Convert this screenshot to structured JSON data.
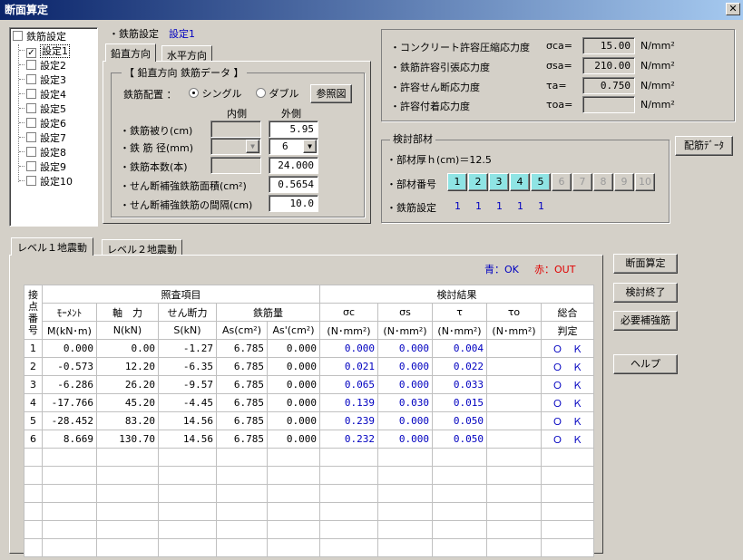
{
  "window": {
    "title": "断面算定",
    "close": "✕"
  },
  "tree": {
    "root": "鉄筋設定",
    "items": [
      "設定1",
      "設定2",
      "設定3",
      "設定4",
      "設定5",
      "設定6",
      "設定7",
      "設定8",
      "設定9",
      "設定10"
    ],
    "checked_index": 0
  },
  "settings": {
    "label": "・鉄筋設定",
    "current": "設定1"
  },
  "tabs_dir": [
    "鉛直方向",
    "水平方向"
  ],
  "rebar": {
    "group_title": "【 鉛直方向 鉄筋データ 】",
    "placement_label": "鉄筋配置 ：",
    "single": "シングル",
    "double": "ダブル",
    "ref_button": "参照図",
    "col_inner": "内側",
    "col_outer": "外側",
    "cover_label": "・鉄筋被り(cm)",
    "cover_value": "5.95",
    "dia_label": "・鉄 筋 径(mm)",
    "dia_value": "6",
    "count_label": "・鉄筋本数(本)",
    "count_value": "24.000",
    "shear_area_label": "・せん断補強鉄筋面積(cm²)",
    "shear_area_value": "0.5654",
    "shear_space_label": "・せん断補強鉄筋の間隔(cm)",
    "shear_space_value": "10.0"
  },
  "stress": {
    "rows": [
      {
        "label": "・コンクリート許容圧縮応力度",
        "sym": "σca=",
        "value": "15.00",
        "unit": "N/mm²"
      },
      {
        "label": "・鉄筋許容引張応力度",
        "sym": "σsa=",
        "value": "210.00",
        "unit": "N/mm²"
      },
      {
        "label": "・許容せん断応力度",
        "sym": "τa=",
        "value": "0.750",
        "unit": "N/mm²"
      },
      {
        "label": "・許容付着応力度",
        "sym": "τoa=",
        "value": "",
        "unit": "N/mm²"
      }
    ]
  },
  "member": {
    "group_title": "検討部材",
    "thickness": "・部材厚ｈ(cm)＝12.5",
    "num_label": "・部材番号",
    "numbers": [
      "1",
      "2",
      "3",
      "4",
      "5",
      "6",
      "7",
      "8",
      "9",
      "10"
    ],
    "active_count": 5,
    "setting_label": "・鉄筋設定",
    "settings": [
      "1",
      "1",
      "1",
      "1",
      "1"
    ],
    "rebar_data_button": "配筋ﾃﾞｰﾀ"
  },
  "level_tabs": [
    "レベル１地震動",
    "レベル２地震動"
  ],
  "legend": {
    "ok": "青：OK",
    "out": "赤：OUT"
  },
  "side_buttons": [
    "断面算定",
    "検討終了",
    "必要補強筋",
    "ヘルプ"
  ],
  "table": {
    "h_node": "接点番号",
    "h_check": "照査項目",
    "h_result": "検討結果",
    "h_moment": "ﾓｰﾒﾝﾄ",
    "h_axial": "軸　力",
    "h_shear": "せん断力",
    "h_rebar": "鉄筋量",
    "h_sc": "σc",
    "h_ss": "σs",
    "h_t": "τ",
    "h_to": "τo",
    "h_total": "総合",
    "u_moment": "M(kN･m)",
    "u_axial": "N(kN)",
    "u_shear": "S(kN)",
    "u_as": "As(cm²)",
    "u_as2": "As'(cm²)",
    "u_sc": "(N･mm²)",
    "u_ss": "(N･mm²)",
    "u_t": "(N･mm²)",
    "u_to": "(N･mm²)",
    "u_total": "判定",
    "rows": [
      {
        "n": "1",
        "m": "0.000",
        "ax": "0.00",
        "s": "-1.27",
        "as": "6.785",
        "as2": "0.000",
        "sc": "0.000",
        "ss": "0.000",
        "t": "0.004",
        "to": "",
        "j": "Ｏ　Ｋ"
      },
      {
        "n": "2",
        "m": "-0.573",
        "ax": "12.20",
        "s": "-6.35",
        "as": "6.785",
        "as2": "0.000",
        "sc": "0.021",
        "ss": "0.000",
        "t": "0.022",
        "to": "",
        "j": "Ｏ　Ｋ"
      },
      {
        "n": "3",
        "m": "-6.286",
        "ax": "26.20",
        "s": "-9.57",
        "as": "6.785",
        "as2": "0.000",
        "sc": "0.065",
        "ss": "0.000",
        "t": "0.033",
        "to": "",
        "j": "Ｏ　Ｋ"
      },
      {
        "n": "4",
        "m": "-17.766",
        "ax": "45.20",
        "s": "-4.45",
        "as": "6.785",
        "as2": "0.000",
        "sc": "0.139",
        "ss": "0.030",
        "t": "0.015",
        "to": "",
        "j": "Ｏ　Ｋ"
      },
      {
        "n": "5",
        "m": "-28.452",
        "ax": "83.20",
        "s": "14.56",
        "as": "6.785",
        "as2": "0.000",
        "sc": "0.239",
        "ss": "0.000",
        "t": "0.050",
        "to": "",
        "j": "Ｏ　Ｋ"
      },
      {
        "n": "6",
        "m": "8.669",
        "ax": "130.70",
        "s": "14.56",
        "as": "6.785",
        "as2": "0.000",
        "sc": "0.232",
        "ss": "0.000",
        "t": "0.050",
        "to": "",
        "j": "Ｏ　Ｋ"
      }
    ],
    "empty_rows": 6
  }
}
